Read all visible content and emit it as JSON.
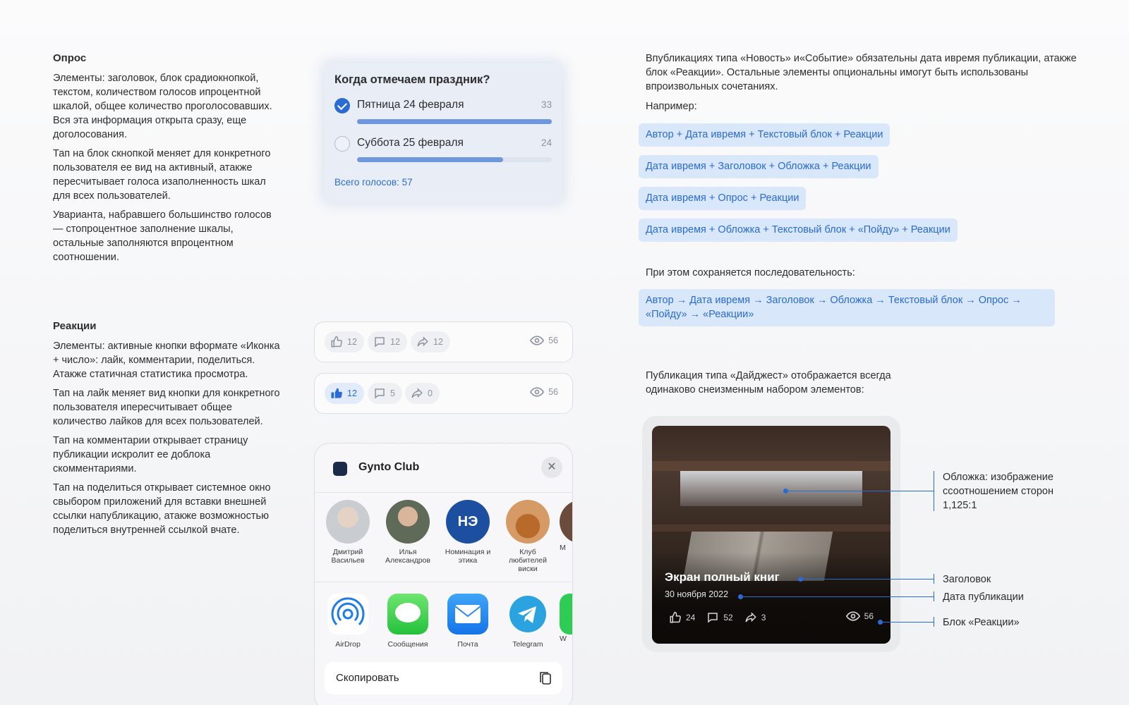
{
  "poll_section": {
    "title": "Опрос",
    "paragraphs": [
      "Элементы: заголовок, блок срадиокнопкой, текстом, количеством голосов ипроцентной шкалой, общее количество проголосовавших. Вся эта информация открыта сразу, еще доголосования.",
      "Тап на блок скнопкой меняет для конкретного пользователя ее вид на активный, атакже пересчитывает голоса изаполненность шкал для всех пользователей.",
      "Уварианта, набравшего большинство голосов — стопроцентное заполнение шкалы, остальные заполняются впроцентном соотношении."
    ]
  },
  "reactions_section": {
    "title": "Реакции",
    "paragraphs": [
      "Элементы: активные кнопки вформате «Иконка + число»: лайк, комментарии, поделиться. Атакже статичная статистика просмотра.",
      "Тап на лайк меняет вид кнопки для конкретного пользователя ипересчитывает общее количество лайков для всех пользователей.",
      "Тап на комментарии открывает страницу публикации искролит ее доблока скомментариями.",
      "Тап на поделиться открывает системное окно свыбором приложений для вставки внешней ссылки напубликацию, атакже возможностью поделиться внутренней ссылкой вчате."
    ]
  },
  "poll_card": {
    "question": "Когда отмечаем праздник?",
    "options": [
      {
        "label": "Пятница 24 февраля",
        "count": "33",
        "selected": true,
        "fill": 1.0
      },
      {
        "label": "Суббота 25 февраля",
        "count": "24",
        "selected": false,
        "fill": 0.75
      }
    ],
    "total": "Всего голосов: 57"
  },
  "reaction_bars": [
    {
      "like": "12",
      "comments": "12",
      "share": "12",
      "views": "56",
      "like_active": false
    },
    {
      "like": "12",
      "comments": "5",
      "share": "0",
      "views": "56",
      "like_active": true
    }
  ],
  "share_sheet": {
    "title": "Gynto Club",
    "close": "✕",
    "contacts": [
      {
        "name": "Дмитрий Васильев",
        "color": "#c9ccd1"
      },
      {
        "name": "Илья Александров",
        "color": "#5f6a58"
      },
      {
        "name": "Номинация и этика",
        "color": "#1d4fa0",
        "badge": "НЭ"
      },
      {
        "name": "Клуб любителей виски",
        "color": "#d69a67"
      },
      {
        "name": "М",
        "color": "#6b4b3b"
      }
    ],
    "apps": [
      {
        "name": "AirDrop",
        "icon": "airdrop-icon"
      },
      {
        "name": "Сообщения",
        "icon": "messages-icon"
      },
      {
        "name": "Почта",
        "icon": "mail-icon"
      },
      {
        "name": "Telegram",
        "icon": "telegram-icon"
      },
      {
        "name": "W",
        "icon": "whatsapp-icon"
      }
    ],
    "copy_label": "Скопировать"
  },
  "right_column": {
    "intro": "Впубликациях типа «Новость» и«Событие» обязательны дата ивремя публикации, атакже блок «Реакции». Остальные элементы опциональны имогут быть использованы впроизвольных сочетаниях.",
    "example_label": "Например:",
    "examples": [
      "Автор + Дата ивремя + Текстовый блок + Реакции",
      "Дата ивремя + Заголовок + Обложка + Реакции",
      "Дата ивремя + Опрос + Реакции",
      "Дата ивремя + Обложка + Текстовый блок + «Пойду» + Реакции"
    ],
    "sequence_label": "При этом сохраняется последовательность:",
    "sequence_line1": "Автор → Дата ивремя → Заголовок → Обложка → Текстовый блок → Опрос →",
    "sequence_line2": "«Пойду» → «Реакции»",
    "digest_intro": "Публикация типа «Дайджест» отображается всегда одинаково снеизменным набором элементов:"
  },
  "digest_card": {
    "title": "Экран полный книг",
    "date": "30 ноября 2022",
    "likes": "24",
    "comments": "52",
    "shares": "3",
    "views": "56"
  },
  "annotations": {
    "cover": "Обложка: изображение ссоотношением сторон 1,125:1",
    "headline": "Заголовок",
    "date": "Дата публикации",
    "reactions": "Блок «Реакции»"
  },
  "colors": {
    "accent": "#2a6bd4",
    "pill_bg": "#d8e7f9",
    "poll_bg": "#e9eef6"
  }
}
